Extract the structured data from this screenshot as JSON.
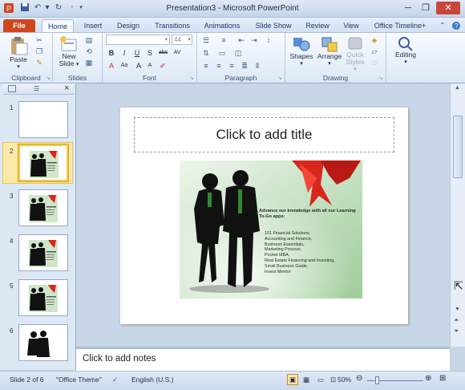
{
  "window": {
    "title": "Presentation3  -  Microsoft PowerPoint",
    "controls": [
      "minimize-icon",
      "restore-icon",
      "close-icon"
    ]
  },
  "tabs": [
    {
      "label": "File"
    },
    {
      "label": "Home"
    },
    {
      "label": "Insert"
    },
    {
      "label": "Design"
    },
    {
      "label": "Transitions"
    },
    {
      "label": "Animations"
    },
    {
      "label": "Slide Show"
    },
    {
      "label": "Review"
    },
    {
      "label": "View"
    },
    {
      "label": "Office Timeline+"
    }
  ],
  "ribbon": {
    "clipboard": {
      "label": "Clipboard",
      "paste": "Paste"
    },
    "slides": {
      "label": "Slides",
      "new_slide": "New Slide"
    },
    "font": {
      "label": "Font",
      "size": "44"
    },
    "paragraph": {
      "label": "Paragraph"
    },
    "drawing": {
      "label": "Drawing",
      "shapes": "Shapes",
      "arrange": "Arrange",
      "quick_styles": "Quick Styles"
    },
    "editing": {
      "label": "Editing"
    }
  },
  "thumbnails": [
    {
      "number": "1",
      "selected": false
    },
    {
      "number": "2",
      "selected": true
    },
    {
      "number": "3",
      "selected": false
    },
    {
      "number": "4",
      "selected": false
    },
    {
      "number": "5",
      "selected": false
    },
    {
      "number": "6",
      "selected": false
    }
  ],
  "slide": {
    "title_placeholder": "Click to add title",
    "picture": {
      "heading": "Advance our knowledge with all our Learning To-Go apps:",
      "apps": [
        "101 Financial Solutions,",
        "Accounting and Finance,",
        "Business Essentials,",
        "Marketing Process,",
        "Pocket MBA,",
        "Real Estate Financing and Investing,",
        "Small Business Guide,",
        "Invest Mentor"
      ]
    }
  },
  "notes_placeholder": "Click to add notes",
  "status": {
    "slide_info": "Slide 2 of 6",
    "theme": "\"Office Theme\"",
    "language": "English (U.S.)",
    "zoom": "50%"
  },
  "colors": {
    "file_tab": "#d0461f",
    "ribbon_bg": "#dde8f5",
    "selection": "#f2c94c",
    "ribbon_accent": "#c9302c"
  }
}
